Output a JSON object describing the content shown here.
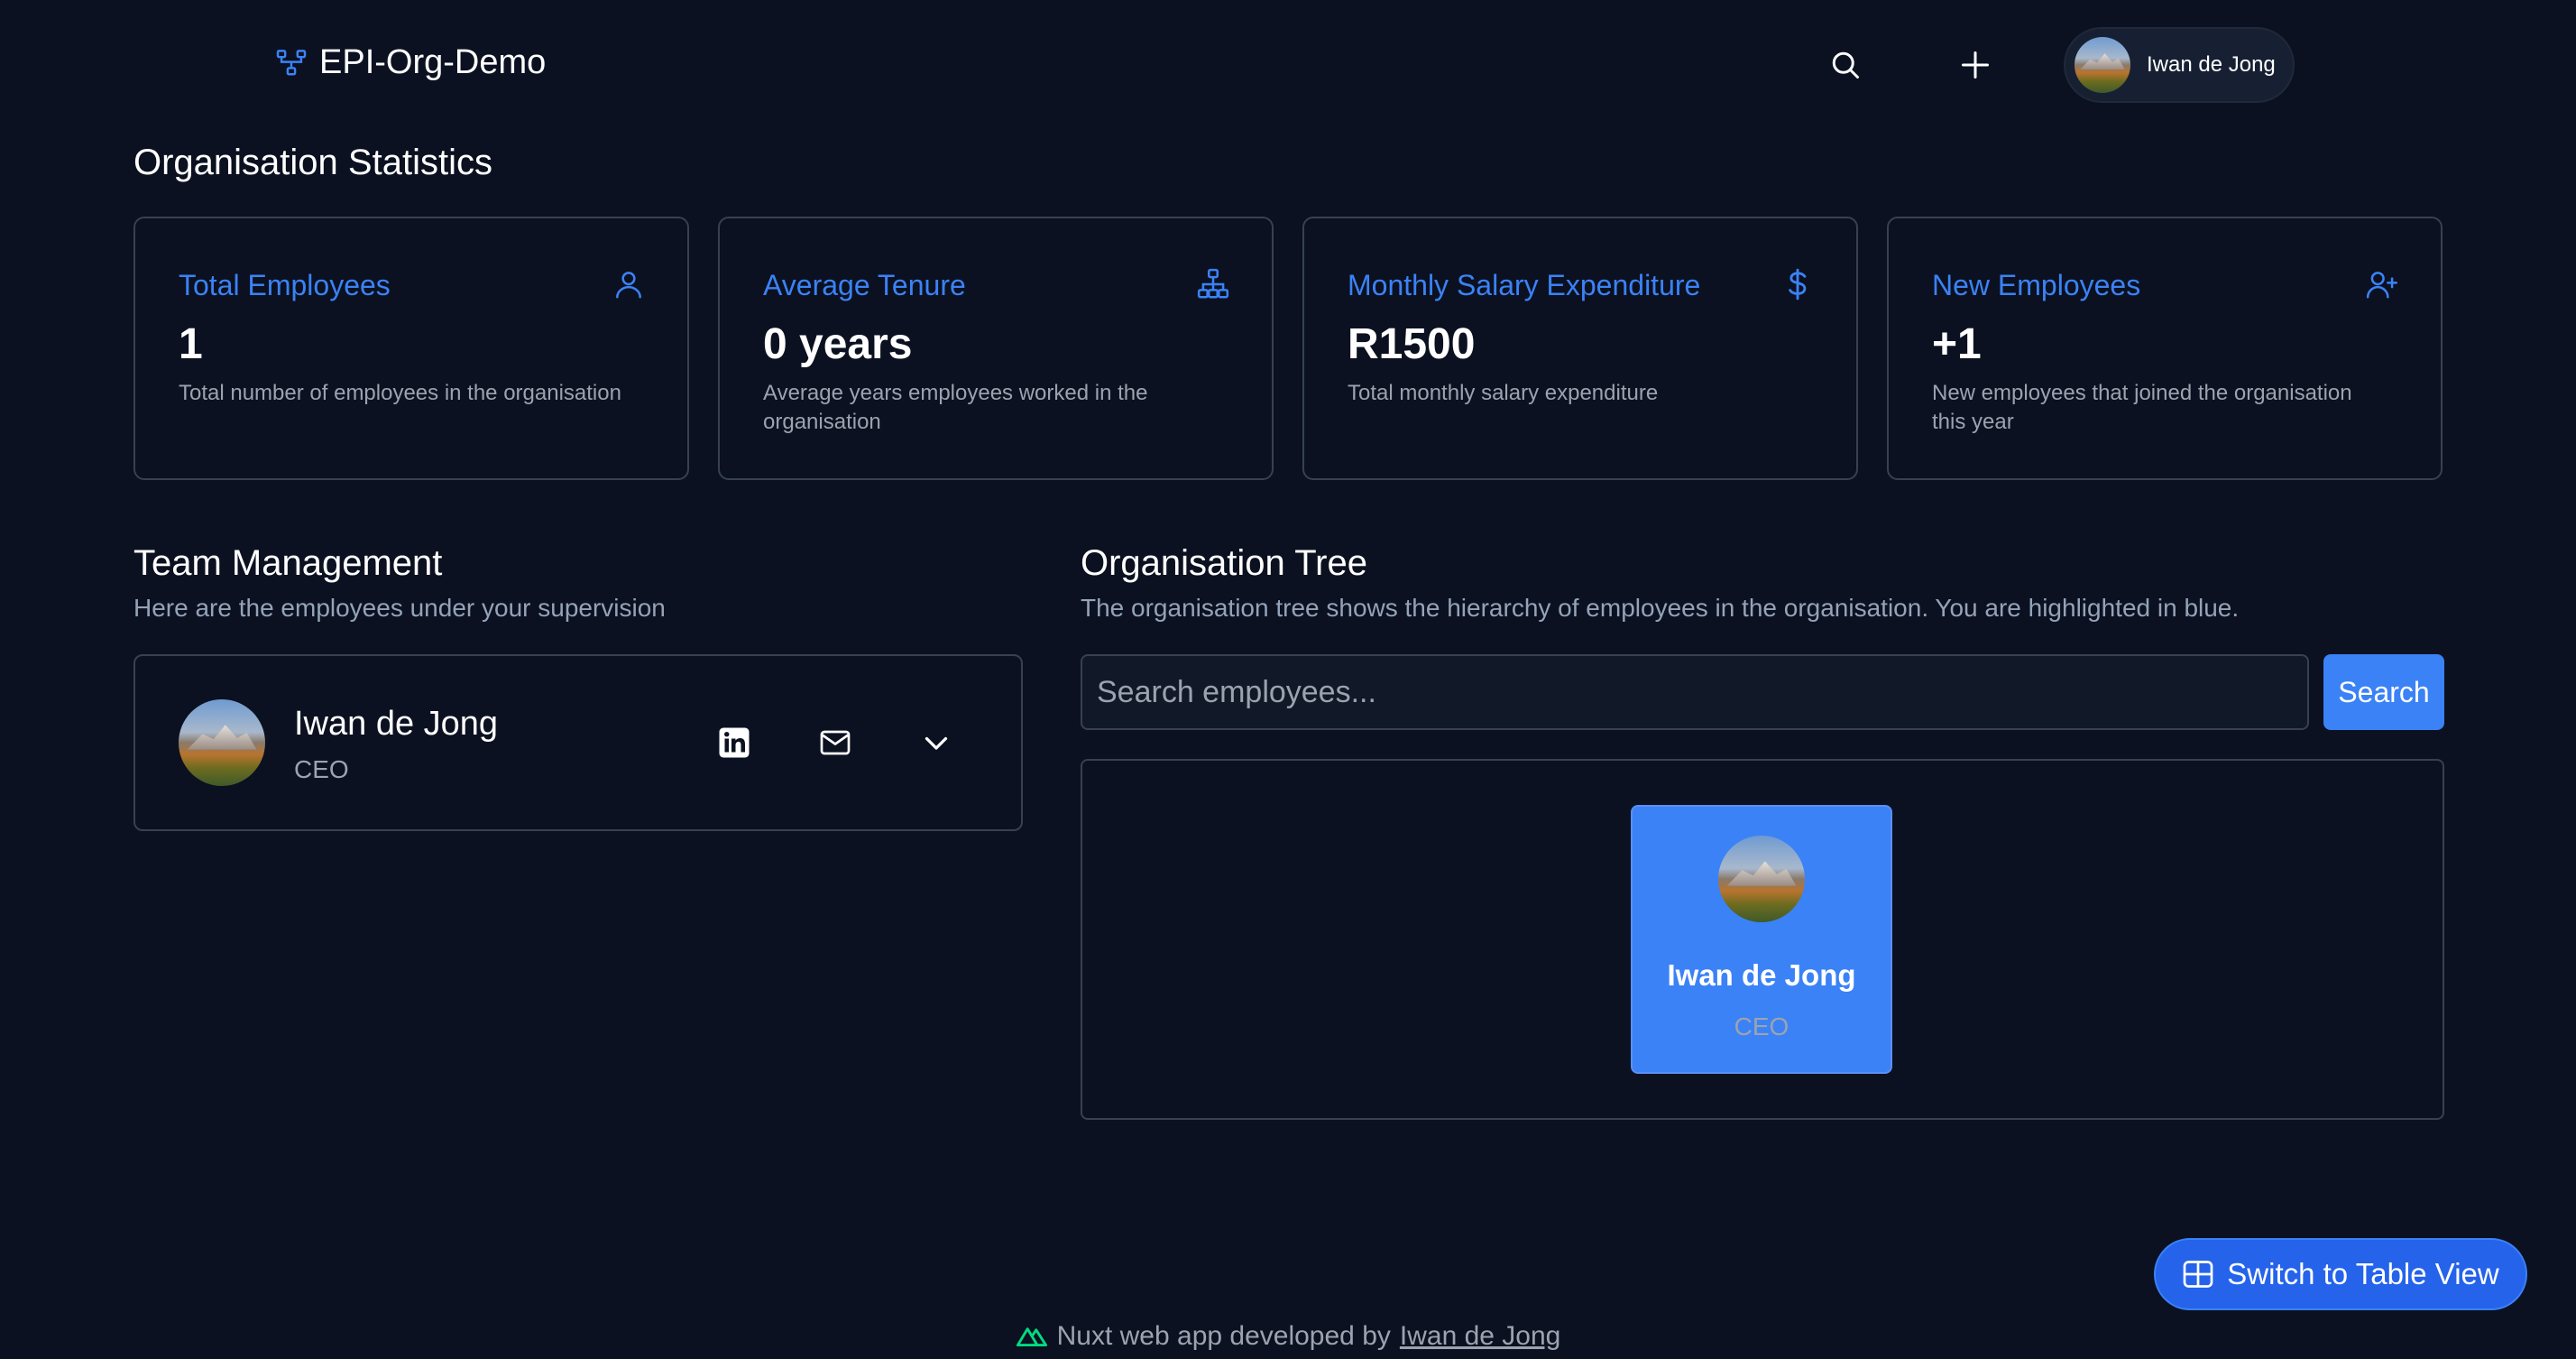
{
  "header": {
    "app_title": "EPI-Org-Demo",
    "logo_icon": "org-chart-icon",
    "search_icon": "search-icon",
    "add_icon": "plus-icon",
    "user_name": "Iwan de Jong"
  },
  "stats": {
    "title": "Organisation Statistics",
    "cards": [
      {
        "label": "Total Employees",
        "value": "1",
        "description": "Total number of employees in the organisation",
        "icon": "user-icon"
      },
      {
        "label": "Average Tenure",
        "value": "0 years",
        "description": "Average years employees worked in the organisation",
        "icon": "hierarchy-icon"
      },
      {
        "label": "Monthly Salary Expenditure",
        "value": "R1500",
        "description": "Total monthly salary expenditure",
        "icon": "dollar-icon"
      },
      {
        "label": "New Employees",
        "value": "+1",
        "description": "New employees that joined the organisation this year",
        "icon": "user-plus-icon"
      }
    ]
  },
  "team": {
    "title": "Team Management",
    "subtitle": "Here are the employees under your supervision",
    "member": {
      "name": "Iwan de Jong",
      "role": "CEO"
    }
  },
  "tree": {
    "title": "Organisation Tree",
    "subtitle": "The organisation tree shows the hierarchy of employees in the organisation. You are highlighted in blue.",
    "search_placeholder": "Search employees...",
    "search_button": "Search",
    "node": {
      "name": "Iwan de Jong",
      "role": "CEO"
    }
  },
  "switch_button": "Switch to Table View",
  "footer": {
    "text": "Nuxt web app developed by",
    "link": "Iwan de Jong"
  },
  "colors": {
    "background": "#0b1120",
    "accent": "#3b82f6",
    "border": "#374151",
    "muted_text": "#9ca3af",
    "nuxt_green": "#00dc82"
  }
}
